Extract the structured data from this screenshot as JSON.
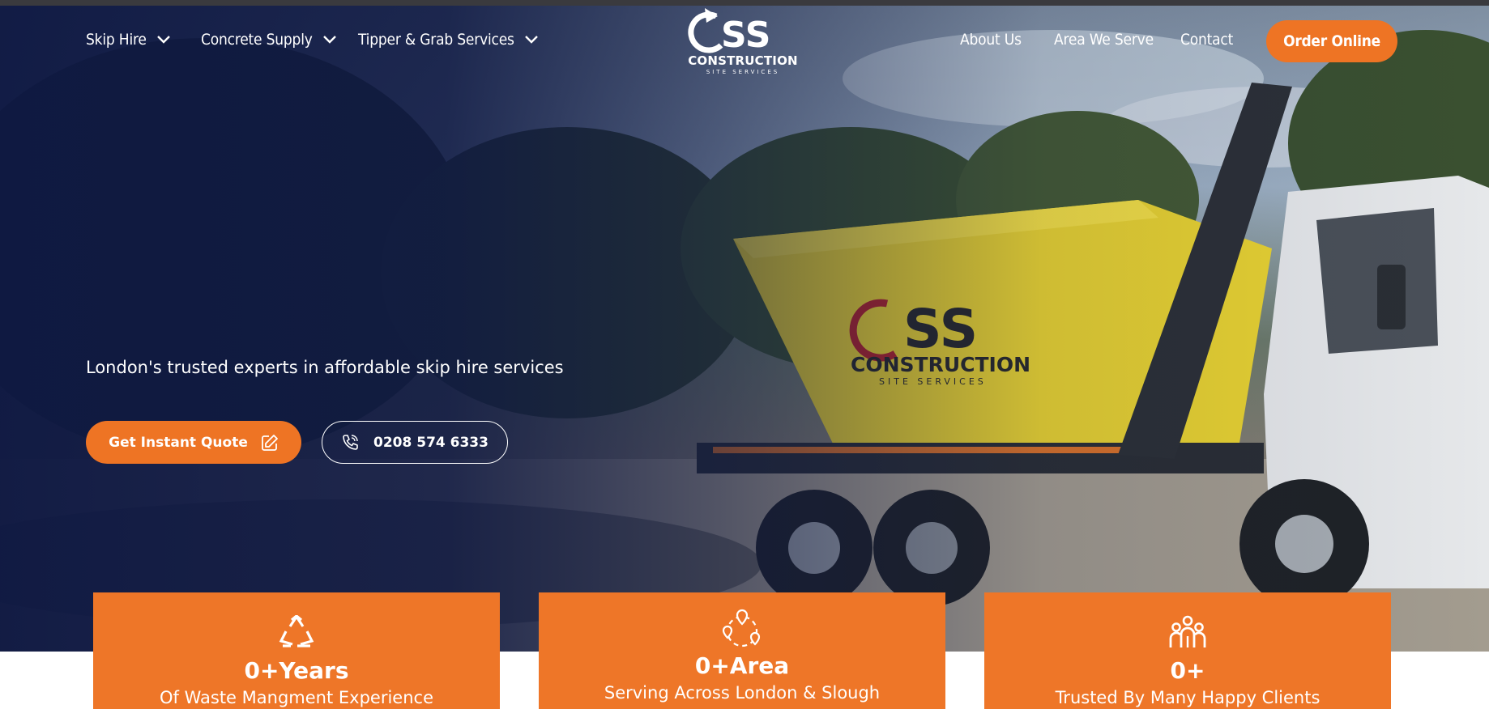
{
  "colors": {
    "accent": "#ee7424",
    "overlay": "#0e1842",
    "white": "#ffffff"
  },
  "nav": {
    "left": [
      {
        "label": "Skip Hire",
        "icon": "chevron-down-icon"
      },
      {
        "label": "Concrete Supply",
        "icon": "chevron-down-icon"
      },
      {
        "label": "Tipper & Grab Services",
        "icon": "chevron-down-icon"
      }
    ],
    "right": [
      {
        "label": "About Us"
      },
      {
        "label": "Area We Serve"
      },
      {
        "label": "Contact"
      }
    ],
    "order_button": "Order Online"
  },
  "logo": {
    "mark": "CSS",
    "word": "CONSTRUCTION",
    "sub": "SITE SERVICES"
  },
  "hero": {
    "tagline": "London's trusted experts in affordable skip hire services",
    "quote_button": {
      "label": "Get Instant Quote",
      "icon": "edit-icon"
    },
    "phone_button": {
      "label": "0208 574 6333",
      "icon": "phone-icon"
    }
  },
  "stats": [
    {
      "icon": "recycle-icon",
      "number": "0+Years",
      "label": "Of Waste Mangment Experience"
    },
    {
      "icon": "map-pins-icon",
      "number": "0+Area",
      "label": "Serving Across London & Slough"
    },
    {
      "icon": "people-icon",
      "number": "0+",
      "label": "Trusted By Many Happy Clients"
    }
  ]
}
